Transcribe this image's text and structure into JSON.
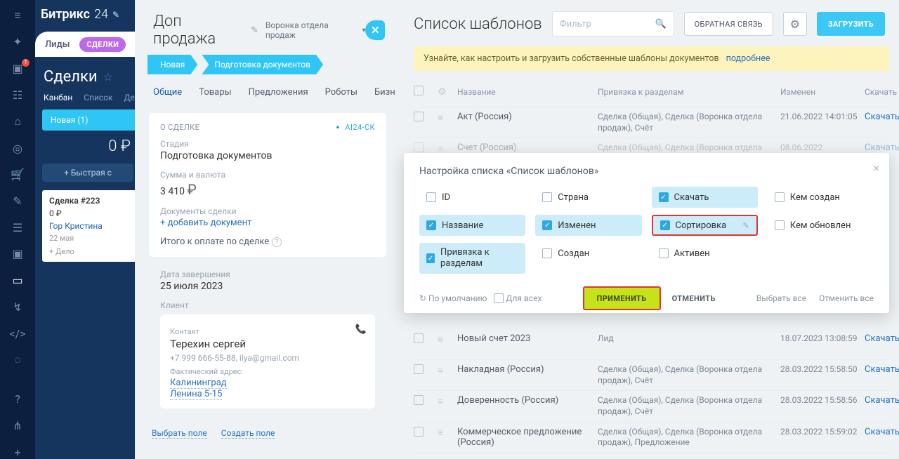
{
  "logo": {
    "brand": "Битрикс",
    "suffix": "24"
  },
  "tabs": {
    "leads": "Лиды",
    "deals": "СДЕЛКИ"
  },
  "deals": {
    "title": "Сделки",
    "views": {
      "kanban": "Канбан",
      "list": "Список",
      "more": "Де"
    },
    "stage_pill": "Новая (1)",
    "total": "0 ₽",
    "quick": "+ Быстрая с",
    "card": {
      "title": "Сделка #223",
      "price": "0 ₽",
      "who": "Гор Кристина",
      "date": "22 мая",
      "add": "+ Дело"
    }
  },
  "deal_panel": {
    "title": "Доп продажа",
    "funnel": "Воронка отдела продаж",
    "stages": {
      "s1": "Новая",
      "s2": "Подготовка документов"
    },
    "tabs": {
      "t1": "Общие",
      "t2": "Товары",
      "t3": "Предложения",
      "t4": "Роботы",
      "t5": "Бизн"
    },
    "about_h": "О СДЕЛКЕ",
    "ai_tag": "🔹 AI24-ск",
    "stage_l": "Стадия",
    "stage_v": "Подготовка документов",
    "sum_l": "Сумма и валюта",
    "sum_v": "3 410",
    "sum_cur": "₽",
    "docs_l": "Документы сделки",
    "docs_add": "+ добавить документ",
    "total_l": "Итого к оплате по сделке",
    "total_q": "?",
    "end_l": "Дата завершения",
    "end_v": "25 июля 2023",
    "client_l": "Клиент",
    "contact_l": "Контакт",
    "contact_v": "Терехин сергей",
    "phone": "+7 999 666-55-88, ilya@gmail.com",
    "addr_l": "Фактический адрес:",
    "city": "Калининград",
    "street": "Ленина 5-15",
    "sel_field": "Выбрать поле",
    "new_field": "Создать поле"
  },
  "tpl": {
    "title": "Список шаблонов",
    "filter_ph": "Фильтр",
    "btn_feedback": "ОБРАТНАЯ СВЯЗЬ",
    "btn_load": "ЗАГРУЗИТЬ",
    "notice": "Узнайте, как настроить и загрузить собственные шаблоны документов",
    "notice_more": "подробнее",
    "headers": {
      "name": "Название",
      "bind": "Привязка к разделам",
      "changed": "Изменен",
      "dl": "Скачать"
    },
    "rows": [
      {
        "name": "Акт (Россия)",
        "bind": "Сделка (Общая), Сделка (Воронка отдела продаж), Счёт",
        "changed": "21.06.2022 14:01:05",
        "dl": "Скачать"
      },
      {
        "name": "Счет (Россия)",
        "bind": "Сделка (Общая), Сделка (Воронка отдела",
        "changed": "08.06.2022",
        "dl": "Скачать"
      },
      {
        "name": "Новый счет 2023",
        "bind": "Лид",
        "changed": "18.07.2023 13:08:59",
        "dl": "Скачать"
      },
      {
        "name": "Накладная (Россия)",
        "bind": "Сделка (Общая), Сделка (Воронка отдела продаж), Счёт",
        "changed": "28.03.2022 15:58:50",
        "dl": "Скачать"
      },
      {
        "name": "Доверенность (Россия)",
        "bind": "Сделка (Общая), Сделка (Воронка отдела продаж), Счёт",
        "changed": "28.03.2022 15:58:56",
        "dl": "Скачать"
      },
      {
        "name": "Коммерческое предложение (Россия)",
        "bind": "Сделка (Общая), Сделка (Воронка отдела продаж), Предложение",
        "changed": "28.03.2022 15:59:02",
        "dl": "Скачать"
      }
    ]
  },
  "modal": {
    "title": "Настройка списка «Список шаблонов»",
    "opts": {
      "id": "ID",
      "country": "Страна",
      "download": "Скачать",
      "created_by": "Кем создан",
      "name": "Название",
      "changed": "Изменен",
      "sort": "Сортировка",
      "updated_by": "Кем обновлен",
      "bind": "Привязка к разделам",
      "created": "Создан",
      "active": "Активен"
    },
    "default": "По умолчанию",
    "for_all": "Для всех",
    "apply": "ПРИМЕНИТЬ",
    "cancel": "ОТМЕНИТЬ",
    "sel_all": "Выбрать все",
    "cancel_all": "Отменить все"
  }
}
